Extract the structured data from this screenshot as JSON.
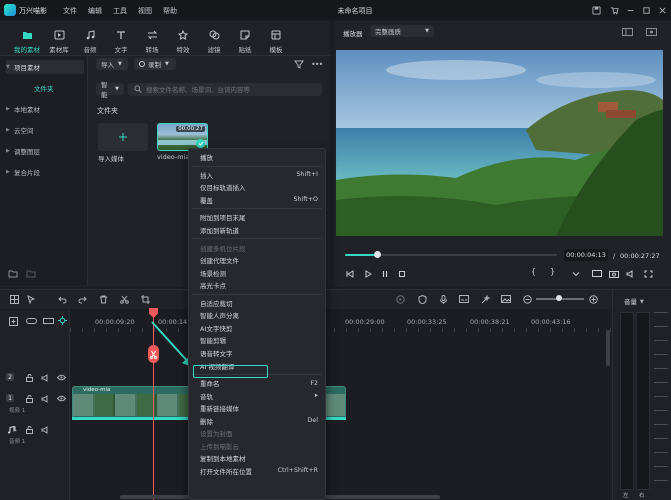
{
  "app": {
    "name": "万兴喵影",
    "menu": [
      "文件",
      "编辑",
      "工具",
      "视图",
      "帮助"
    ],
    "document_title": "未命名项目"
  },
  "toolbar_tabs": [
    {
      "label": "我的素材",
      "icon": "folder-icon",
      "active": true
    },
    {
      "label": "素材库",
      "icon": "library-icon",
      "active": false
    },
    {
      "label": "音频",
      "icon": "music-icon",
      "active": false
    },
    {
      "label": "文字",
      "icon": "text-icon",
      "active": false
    },
    {
      "label": "转场",
      "icon": "transition-icon",
      "active": false
    },
    {
      "label": "特效",
      "icon": "effects-icon",
      "active": false
    },
    {
      "label": "滤镜",
      "icon": "filter-icon",
      "active": false
    },
    {
      "label": "贴纸",
      "icon": "sticker-icon",
      "active": false
    },
    {
      "label": "模板",
      "icon": "template-icon",
      "active": false
    }
  ],
  "sidebar": {
    "items": [
      {
        "label": "项目素材",
        "expanded": true
      },
      {
        "label": "文件夹",
        "sub": true
      },
      {
        "label": "本地素材"
      },
      {
        "label": "云空间"
      },
      {
        "label": "调整图层"
      },
      {
        "label": "复合片段"
      }
    ]
  },
  "media": {
    "import_label": "导入",
    "record_label": "录制",
    "smart_label": "智能",
    "search_placeholder": "搜索文件名称、场景词、台词内容等",
    "folder_heading": "文件夹",
    "import_tile_label": "导入媒体",
    "video_name": "video-mia",
    "video_duration": "00:00:27"
  },
  "player": {
    "tab_label": "播放器",
    "quality": "完整画质",
    "current_time": "00:00:04:13",
    "separator": "/",
    "total_time": "00:00:27:27",
    "progress": 0.15
  },
  "timeline": {
    "ruler": [
      "00:00:09:20",
      "00:00:14:1",
      "00:00:29:00",
      "00:00:33:25",
      "00:00:38:21",
      "00:00:43:16"
    ],
    "tracks": [
      {
        "num": "2",
        "name": ""
      },
      {
        "num": "1",
        "name": "视频 1"
      },
      {
        "num": "1",
        "name": "音频 1"
      }
    ],
    "clip_label": "video-mia",
    "volume_label": "音量",
    "meter_labels": [
      "左",
      "右"
    ]
  },
  "context_menu": {
    "items": [
      {
        "label": "播放",
        "shortcut": "",
        "disabled": false
      },
      {
        "sep": true
      },
      {
        "label": "插入",
        "shortcut": "Shift+I",
        "disabled": false
      },
      {
        "label": "仅目标轨道插入",
        "shortcut": "",
        "disabled": false
      },
      {
        "label": "覆盖",
        "shortcut": "Shift+O",
        "disabled": false
      },
      {
        "sep": true
      },
      {
        "label": "附加到项目末尾",
        "shortcut": "",
        "disabled": false
      },
      {
        "label": "添加到新轨道",
        "shortcut": "",
        "disabled": false
      },
      {
        "sep": true
      },
      {
        "label": "创建多机位片段",
        "shortcut": "",
        "disabled": true
      },
      {
        "label": "创建代理文件",
        "shortcut": "",
        "disabled": false
      },
      {
        "label": "场景检测",
        "shortcut": "",
        "disabled": false
      },
      {
        "label": "高光卡点",
        "shortcut": "",
        "disabled": false
      },
      {
        "sep": true
      },
      {
        "label": "自适应裁切",
        "shortcut": "",
        "disabled": false
      },
      {
        "label": "智能人声分离",
        "shortcut": "",
        "disabled": false
      },
      {
        "label": "AI文字快剪",
        "shortcut": "",
        "disabled": false
      },
      {
        "label": "智能剪辑",
        "shortcut": "",
        "disabled": false
      },
      {
        "label": "语音转文字",
        "shortcut": "",
        "disabled": false,
        "highlighted": true
      },
      {
        "label": "AI 视频翻译",
        "shortcut": "",
        "disabled": false
      },
      {
        "sep": true
      },
      {
        "label": "重命名",
        "shortcut": "F2",
        "disabled": false
      },
      {
        "label": "音轨",
        "shortcut": "▸",
        "disabled": false
      },
      {
        "label": "重新链接媒体",
        "shortcut": "",
        "disabled": false
      },
      {
        "label": "删除",
        "shortcut": "Del",
        "disabled": false
      },
      {
        "label": "设置为封面",
        "shortcut": "",
        "disabled": true
      },
      {
        "label": "上传到喵影云",
        "shortcut": "",
        "disabled": true
      },
      {
        "label": "复制到本地素材",
        "shortcut": "",
        "disabled": false
      },
      {
        "label": "打开文件所在位置",
        "shortcut": "Ctrl+Shift+R",
        "disabled": false
      }
    ]
  },
  "colors": {
    "accent": "#36d8c4",
    "playhead": "#f05a5a",
    "panel": "#202227",
    "menu_bg": "#26282e"
  }
}
